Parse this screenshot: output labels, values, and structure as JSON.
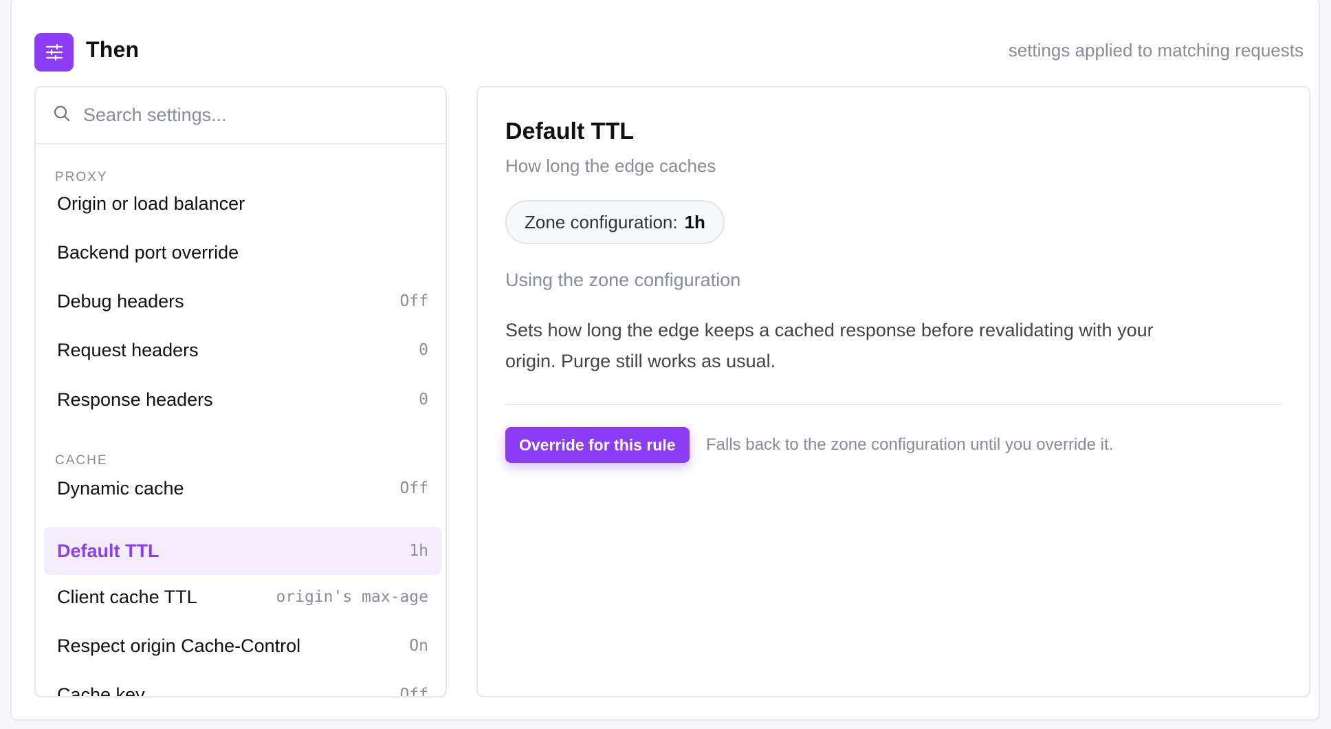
{
  "colors": {
    "accent": "#8b3df5",
    "active_bg": "#f3edfd",
    "muted_text": "#8a8d96",
    "border": "#e7e7ec"
  },
  "header": {
    "icon": "sliders-icon",
    "title": "Then",
    "subtitle": "settings applied to matching requests"
  },
  "sidebar": {
    "search": {
      "icon": "search-icon",
      "placeholder": "Search settings..."
    },
    "sections": [
      {
        "label": "PROXY",
        "items": [
          {
            "label": "Origin or load balancer",
            "value": ""
          },
          {
            "label": "Backend port override",
            "value": ""
          },
          {
            "label": "Debug headers",
            "value": "Off"
          },
          {
            "label": "Request headers",
            "value": "0"
          },
          {
            "label": "Response headers",
            "value": "0"
          }
        ]
      },
      {
        "label": "CACHE",
        "items": [
          {
            "label": "Dynamic cache",
            "value": "Off"
          },
          {
            "label": "Default TTL",
            "value": "1h",
            "active": true
          },
          {
            "label": "Client cache TTL",
            "value": "origin's max-age"
          },
          {
            "label": "Respect origin Cache-Control",
            "value": "On"
          },
          {
            "label": "Cache key",
            "value": "Off"
          }
        ]
      }
    ]
  },
  "panel": {
    "title": "Default TTL",
    "description": "How long the edge caches",
    "zone_pill": {
      "label": "Zone configuration:",
      "value": "1h"
    },
    "status": "Using the zone configuration",
    "body": "Sets how long the edge keeps a cached response before revalidating with your origin. Purge still works as usual.",
    "override_button": "Override for this rule",
    "fallback_note": "Falls back to the zone configuration until you override it."
  }
}
